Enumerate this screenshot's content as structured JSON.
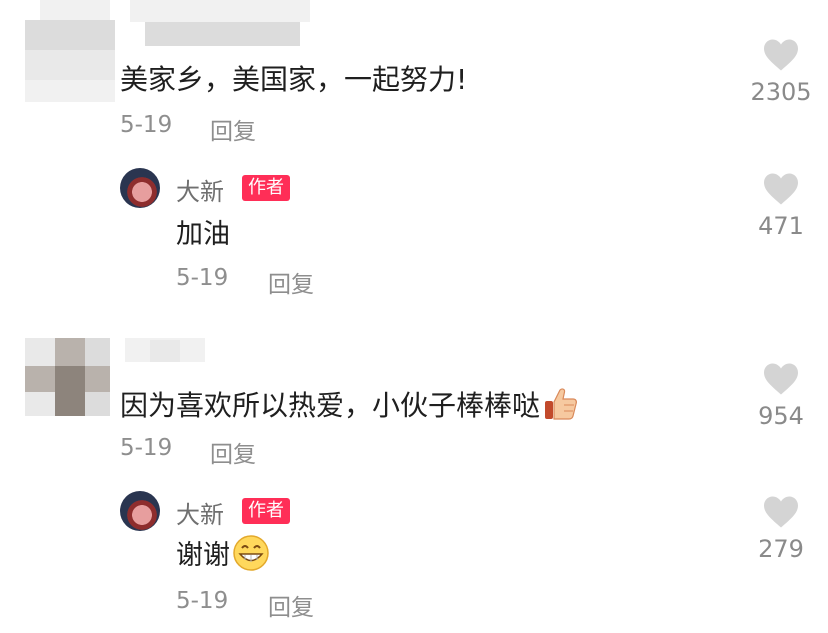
{
  "comments": [
    {
      "text": "美家乡，美国家，一起努力!",
      "date": "5-19",
      "reply_label": "回复",
      "likes": "2305",
      "reply": {
        "author": "大新",
        "badge": "作者",
        "text": "加油",
        "date": "5-19",
        "reply_label": "回复",
        "likes": "471"
      }
    },
    {
      "text": "因为喜欢所以热爱，小伙子棒棒哒",
      "emoji": "thumbs-up",
      "date": "5-19",
      "reply_label": "回复",
      "likes": "954",
      "reply": {
        "author": "大新",
        "badge": "作者",
        "text": "谢谢",
        "emoji": "grin",
        "date": "5-19",
        "reply_label": "回复",
        "likes": "279"
      }
    }
  ],
  "colors": {
    "badge_bg": "#ff2e57",
    "meta_gray": "#8e8e8e",
    "heart_gray": "#d4d4d4"
  },
  "icons": [
    "heart-icon",
    "thumbs-up-emoji",
    "grin-emoji"
  ]
}
